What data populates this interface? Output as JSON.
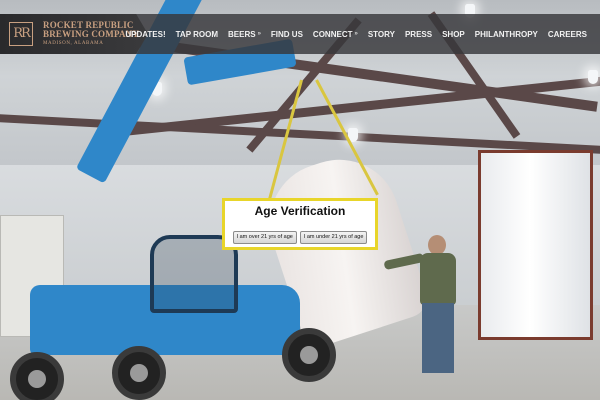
{
  "site": {
    "logo_mark": "RR",
    "logo_line1": "ROCKET REPUBLIC",
    "logo_line2": "BREWING COMPANY",
    "logo_sub": "MADISON, ALABAMA"
  },
  "nav": {
    "items": [
      {
        "label": "UPDATES!",
        "has_dropdown": false
      },
      {
        "label": "TAP ROOM",
        "has_dropdown": false
      },
      {
        "label": "BEERS",
        "has_dropdown": true
      },
      {
        "label": "FIND US",
        "has_dropdown": false
      },
      {
        "label": "CONNECT",
        "has_dropdown": true
      },
      {
        "label": "STORY",
        "has_dropdown": false
      },
      {
        "label": "PRESS",
        "has_dropdown": false
      },
      {
        "label": "SHOP",
        "has_dropdown": false
      },
      {
        "label": "PHILANTHROPY",
        "has_dropdown": false
      },
      {
        "label": "CAREERS",
        "has_dropdown": false
      }
    ],
    "dropdown_glyph": "»"
  },
  "age_gate": {
    "title": "Age Verification",
    "over_label": "I am over 21 yrs of age",
    "under_label": "I am under 21 yrs of age",
    "border_color": "#e8d52a"
  },
  "colors": {
    "header_bg": "#37373a",
    "logo_text": "#c9a081",
    "nav_text": "#f2f2f2"
  }
}
